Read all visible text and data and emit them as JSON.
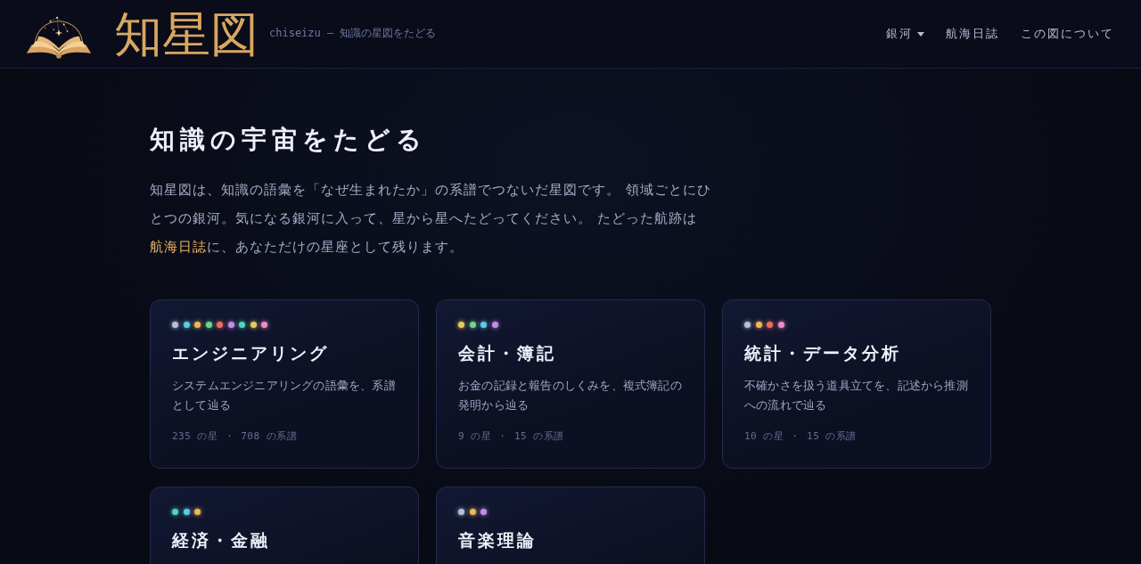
{
  "header": {
    "logo_title": "知星図",
    "tagline": "chiseizu — 知識の星図をたどる",
    "nav": [
      {
        "label": "銀河",
        "kind": "dropdown"
      },
      {
        "label": "航海日誌",
        "kind": "link"
      },
      {
        "label": "この図について",
        "kind": "link"
      }
    ]
  },
  "intro": {
    "heading": "知識の宇宙をたどる",
    "text_before": "知星図は、知識の語彙を「なぜ生まれたか」の系譜でつないだ星図です。 領域ごとにひとつの銀河。気になる銀河に入って、星から星へたどってください。 たどった航跡は",
    "link": "航海日誌",
    "text_after": "に、あなただけの星座として残ります。"
  },
  "galaxies": [
    {
      "title": "エンジニアリング",
      "description": "システムエンジニアリングの語彙を、系譜として辿る",
      "stats": "235 の星 ・ 708 の系譜",
      "dots": [
        {
          "color": "#b9bdda"
        },
        {
          "color": "#5ccbe8"
        },
        {
          "color": "#f3b55a"
        },
        {
          "color": "#6fd58c"
        },
        {
          "color": "#ef6b5b"
        },
        {
          "color": "#c48ce8"
        },
        {
          "color": "#4fd4c0"
        },
        {
          "color": "#e6cb5c"
        },
        {
          "color": "#f08cc4"
        }
      ]
    },
    {
      "title": "会計・簿記",
      "description": "お金の記録と報告のしくみを、複式簿記の発明から辿る",
      "stats": "9 の星 ・ 15 の系譜",
      "dots": [
        {
          "color": "#e6cb5c"
        },
        {
          "color": "#6fd58c"
        },
        {
          "color": "#5ccbe8"
        },
        {
          "color": "#c48ce8"
        }
      ]
    },
    {
      "title": "統計・データ分析",
      "description": "不確かさを扱う道具立てを、記述から推測への流れで辿る",
      "stats": "10 の星 ・ 15 の系譜",
      "dots": [
        {
          "color": "#b9bdda"
        },
        {
          "color": "#f3b55a"
        },
        {
          "color": "#ef6b5b"
        },
        {
          "color": "#f08cc4"
        }
      ]
    },
    {
      "title": "経済・金融",
      "dots": [
        {
          "color": "#4fd4c0"
        },
        {
          "color": "#5ccbe8"
        },
        {
          "color": "#f3b55a"
        }
      ]
    },
    {
      "title": "音楽理論",
      "dots": [
        {
          "color": "#b9bdda"
        },
        {
          "color": "#f3b55a"
        },
        {
          "color": "#c48ce8"
        }
      ]
    }
  ]
}
